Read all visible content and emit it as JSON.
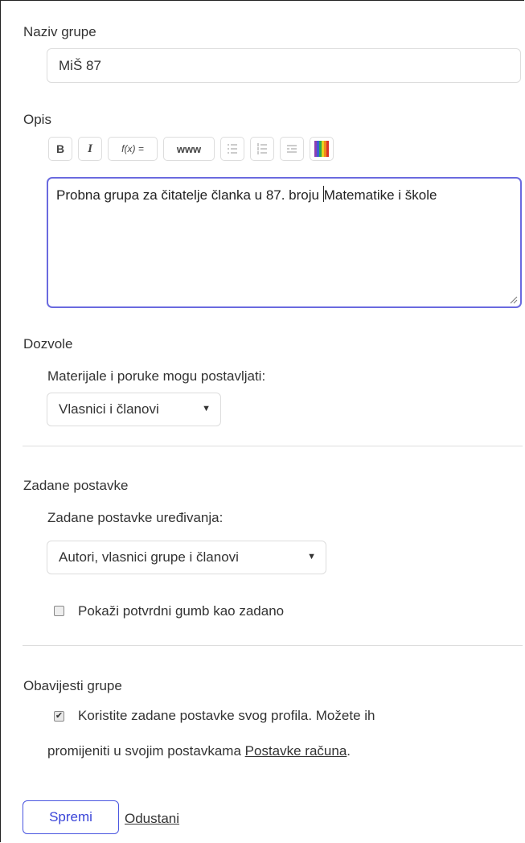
{
  "name_section": {
    "label": "Naziv grupe",
    "value": "MiŠ 87"
  },
  "desc_section": {
    "label": "Opis",
    "toolbar": {
      "bold": "B",
      "italic": "I",
      "formula": "f(x) =",
      "link": "www"
    },
    "text_before_caret": "Probna grupa za čitatelje članka u 87. broju ",
    "text_after_caret": "Matematike i škole"
  },
  "permissions": {
    "label": "Dozvole",
    "sub_label": "Materijale i poruke mogu postavljati:",
    "select_value": "Vlasnici i članovi"
  },
  "defaults": {
    "label": "Zadane postavke",
    "sub_label": "Zadane postavke uređivanja:",
    "select_value": "Autori, vlasnici grupe i članovi",
    "checkbox_label": "Pokaži potvrdni gumb kao zadano",
    "checkbox_checked": false
  },
  "notifications": {
    "label": "Obavijesti grupe",
    "checkbox_checked": true,
    "text_line1": "Koristite zadane postavke svog profila. Možete ih",
    "text_line2": "promijeniti u svojim postavkama ",
    "link": "Postavke računa",
    "text_end": "."
  },
  "actions": {
    "save": "Spremi",
    "cancel": "Odustani"
  },
  "colors": {
    "accent": "#4a56e0",
    "focus_border": "#6a6adf",
    "text": "#333333",
    "divider": "#dddddd"
  }
}
